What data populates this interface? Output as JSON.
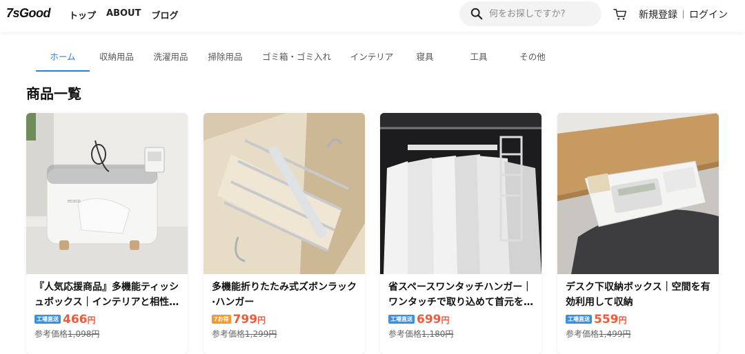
{
  "header": {
    "logo": "7sGood",
    "nav": [
      "トップ",
      "ABOUT",
      "ブログ"
    ],
    "search_placeholder": "何をお探しですか?",
    "register": "新規登録",
    "login": "ログイン"
  },
  "tabs": [
    {
      "label": "ホーム",
      "active": true
    },
    {
      "label": "収納用品"
    },
    {
      "label": "洗濯用品"
    },
    {
      "label": "掃除用品"
    },
    {
      "label": "ゴミ箱・ゴミ入れ"
    },
    {
      "label": "インテリア"
    },
    {
      "label": "寝具"
    },
    {
      "label": "工具"
    },
    {
      "label": "その他"
    }
  ],
  "section_title": "商品一覧",
  "products": [
    {
      "name": "『人気応援商品』多機能ティッシュボックス｜インテリアと相性…",
      "badge": "工場直送",
      "badge_color": "#3e8fe0",
      "price": "466",
      "yen": "円",
      "ref_label": "参考価格",
      "ref_price": "1,098円"
    },
    {
      "name": "多機能折りたたみ式ズボンラック·ハンガー",
      "badge": "7お得",
      "badge_color": "#f29a2e",
      "price": "799",
      "yen": "円",
      "ref_label": "参考価格",
      "ref_price": "1,299円"
    },
    {
      "name": "省スペースワンタッチハンガー｜ワンタッチで取り込めて首元を…",
      "badge": "工場直送",
      "badge_color": "#3e8fe0",
      "price": "699",
      "yen": "円",
      "ref_label": "参考価格",
      "ref_price": "1,180円"
    },
    {
      "name": "デスク下収納ボックス｜空間を有効利用して収納",
      "badge": "工場直送",
      "badge_color": "#3e8fe0",
      "price": "559",
      "yen": "円",
      "ref_label": "参考価格",
      "ref_price": "1,499円"
    }
  ],
  "product_images": [
    "tissue-box-photo",
    "pants-hanger-photo",
    "clothes-hanger-photo",
    "desk-drawer-photo"
  ],
  "accent_color": "#2f7fd6",
  "price_color": "#ef5a3c"
}
